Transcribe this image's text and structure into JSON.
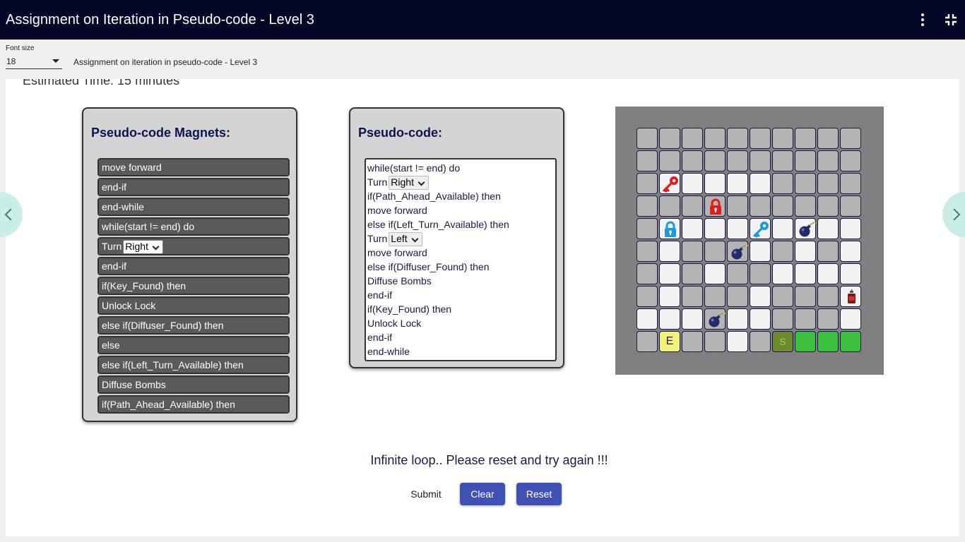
{
  "header": {
    "title": "Assignment on Iteration in Pseudo-code - Level 3",
    "menu_icon": "more-vert-icon",
    "collapse_icon": "fullscreen-exit-icon"
  },
  "toolbar": {
    "font_size_label": "Font size",
    "font_size_value": "18",
    "breadcrumb": "Assignment on iteration in pseudo-code - Level 3"
  },
  "content": {
    "estimated_time": "Estimated Time: 15 minutes"
  },
  "magnets_panel": {
    "title": "Pseudo-code Magnets:",
    "items": [
      {
        "text": "move forward"
      },
      {
        "text": "end-if"
      },
      {
        "text": "end-while"
      },
      {
        "text": "while(start != end) do"
      },
      {
        "text": "Turn",
        "select": "Right"
      },
      {
        "text": "end-if"
      },
      {
        "text": "if(Key_Found) then"
      },
      {
        "text": "Unlock Lock"
      },
      {
        "text": "else if(Diffuser_Found) then"
      },
      {
        "text": "else"
      },
      {
        "text": "else if(Left_Turn_Available) then"
      },
      {
        "text": "Diffuse Bombs"
      },
      {
        "text": "if(Path_Ahead_Available) then"
      }
    ]
  },
  "code_panel": {
    "title": "Pseudo-code:",
    "lines": [
      {
        "text": "while(start != end) do"
      },
      {
        "text": "Turn",
        "select": "Right"
      },
      {
        "text": "if(Path_Ahead_Available) then"
      },
      {
        "text": "move forward"
      },
      {
        "text": "else if(Left_Turn_Available) then"
      },
      {
        "text": "Turn",
        "select": "Left"
      },
      {
        "text": "move forward"
      },
      {
        "text": "else if(Diffuser_Found) then"
      },
      {
        "text": "Diffuse Bombs"
      },
      {
        "text": "end-if"
      },
      {
        "text": "if(Key_Found) then"
      },
      {
        "text": "Unlock Lock"
      },
      {
        "text": "end-if"
      },
      {
        "text": "end-while"
      }
    ]
  },
  "board": {
    "rows": [
      "gggggggggg",
      "gggggggggg",
      "gwwwwwgggg",
      "gggggggggg",
      "gwwwwwwwww",
      "gwgggwgwgw",
      "gwgwggwwww",
      "gwgggwgggw",
      "wwwgwwgggw",
      "gYggwgDGGG"
    ],
    "items": [
      {
        "row": 2,
        "col": 1,
        "type": "key",
        "color": "#e41b1b",
        "icon": "red-key-icon"
      },
      {
        "row": 3,
        "col": 3,
        "type": "lock",
        "color": "#e41b1b",
        "icon": "red-lock-icon"
      },
      {
        "row": 4,
        "col": 1,
        "type": "lock",
        "color": "#1a9be0",
        "icon": "blue-lock-icon"
      },
      {
        "row": 4,
        "col": 5,
        "type": "key",
        "color": "#1a9be0",
        "icon": "blue-key-icon"
      },
      {
        "row": 4,
        "col": 7,
        "type": "bomb",
        "icon": "bomb-icon"
      },
      {
        "row": 5,
        "col": 4,
        "type": "bomb",
        "icon": "bomb-icon"
      },
      {
        "row": 7,
        "col": 9,
        "type": "diffuser",
        "icon": "diffuser-icon"
      },
      {
        "row": 8,
        "col": 3,
        "type": "bomb",
        "icon": "bomb-icon"
      },
      {
        "row": 9,
        "col": 1,
        "type": "end",
        "label": "E"
      },
      {
        "row": 9,
        "col": 6,
        "type": "start",
        "label": "S"
      }
    ]
  },
  "status_message": "Infinite loop.. Please reset and try again !!!",
  "buttons": {
    "submit": "Submit",
    "clear": "Clear",
    "reset": "Reset"
  },
  "colors": {
    "header_bg": "#040627",
    "button_primary": "#3f51b5",
    "nav_bg": "#c8eee6"
  }
}
